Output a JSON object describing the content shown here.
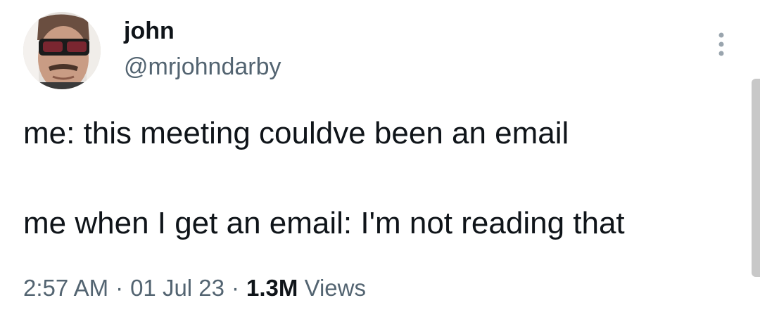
{
  "user": {
    "display_name": "john",
    "handle": "@mrjohndarby"
  },
  "tweet": {
    "line1": "me: this meeting couldve been an email",
    "line2": "me when I get an email: I'm not reading that"
  },
  "meta": {
    "time": "2:57 AM",
    "separator": "·",
    "date": "01 Jul 23",
    "views_count": "1.3M",
    "views_label": "Views"
  },
  "icons": {
    "more": "more-vertical-icon",
    "avatar": "profile-photo"
  }
}
